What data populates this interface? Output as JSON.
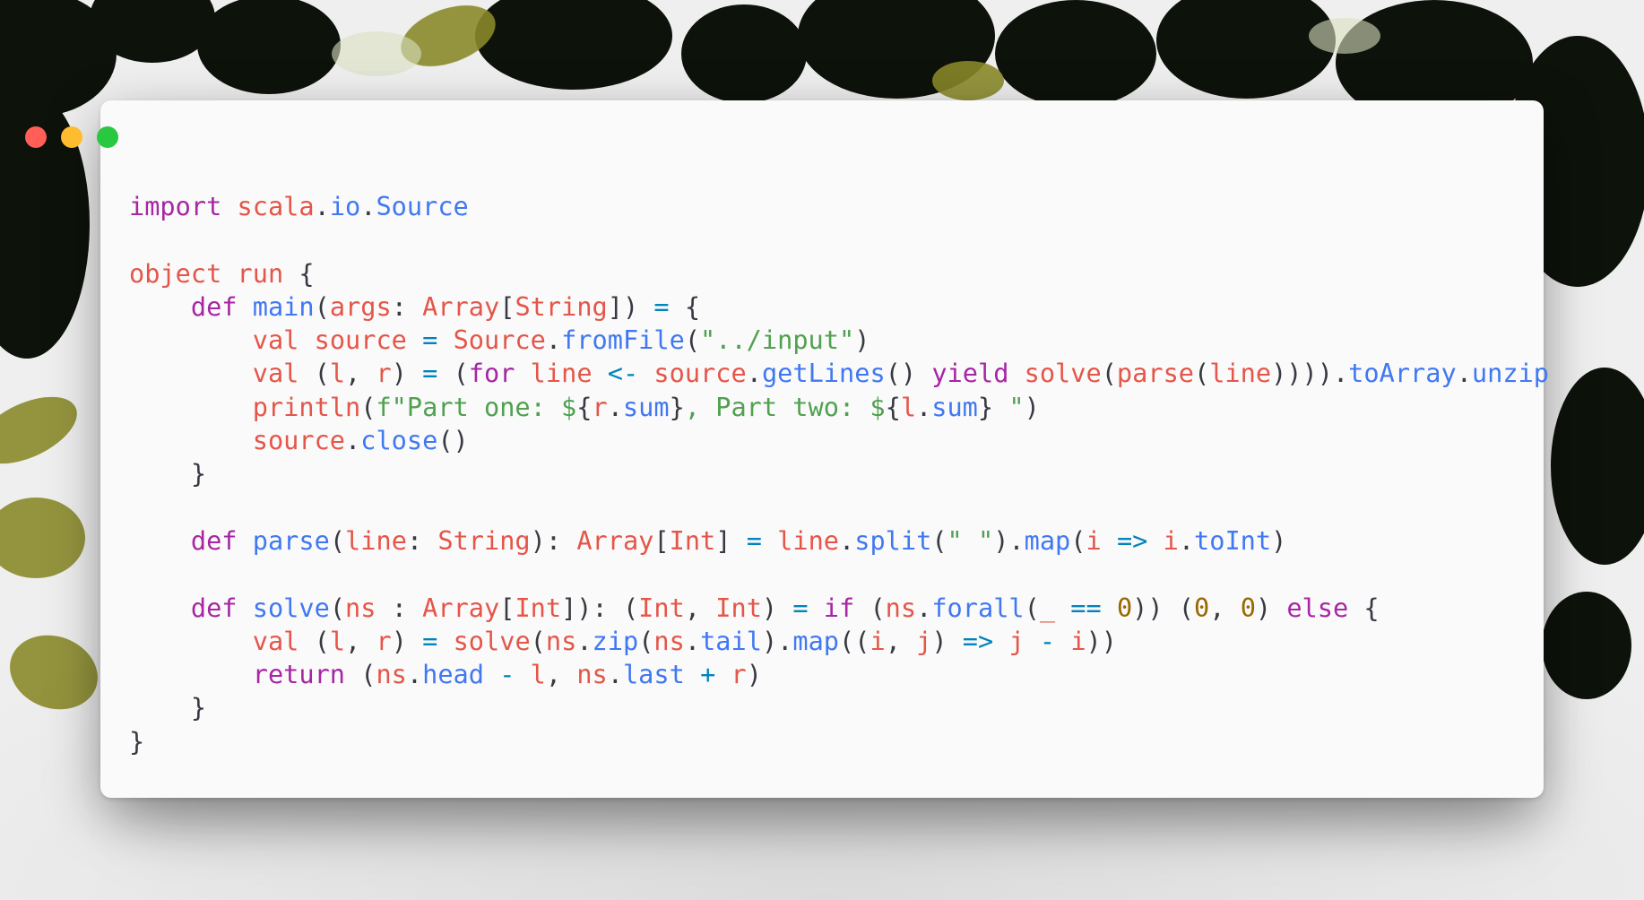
{
  "window": {
    "buttons": [
      {
        "name": "close-button",
        "color": "#ff5f57"
      },
      {
        "name": "minimize-button",
        "color": "#febc2e"
      },
      {
        "name": "maximize-button",
        "color": "#28c840"
      }
    ]
  },
  "colors": {
    "keyword": "#a626a4",
    "identifier": "#e45649",
    "method": "#4078f2",
    "string": "#50a14f",
    "number": "#986801",
    "operator": "#0184bc",
    "plain": "#383a42"
  },
  "code": {
    "language": "Scala",
    "lines": [
      [
        [
          "keyword",
          "import"
        ],
        [
          "plain",
          " "
        ],
        [
          "identifier",
          "scala"
        ],
        [
          "plain",
          "."
        ],
        [
          "method",
          "io"
        ],
        [
          "plain",
          "."
        ],
        [
          "method",
          "Source"
        ]
      ],
      [],
      [
        [
          "identifier",
          "object"
        ],
        [
          "plain",
          " "
        ],
        [
          "identifier",
          "run"
        ],
        [
          "plain",
          " {"
        ]
      ],
      [
        [
          "plain",
          "    "
        ],
        [
          "keyword",
          "def"
        ],
        [
          "plain",
          " "
        ],
        [
          "method",
          "main"
        ],
        [
          "plain",
          "("
        ],
        [
          "identifier",
          "args"
        ],
        [
          "plain",
          ": "
        ],
        [
          "identifier",
          "Array"
        ],
        [
          "plain",
          "["
        ],
        [
          "identifier",
          "String"
        ],
        [
          "plain",
          "]) "
        ],
        [
          "operator",
          "="
        ],
        [
          "plain",
          " {"
        ]
      ],
      [
        [
          "plain",
          "        "
        ],
        [
          "identifier",
          "val"
        ],
        [
          "plain",
          " "
        ],
        [
          "identifier",
          "source"
        ],
        [
          "plain",
          " "
        ],
        [
          "operator",
          "="
        ],
        [
          "plain",
          " "
        ],
        [
          "identifier",
          "Source"
        ],
        [
          "plain",
          "."
        ],
        [
          "method",
          "fromFile"
        ],
        [
          "plain",
          "("
        ],
        [
          "string",
          "\"../input\""
        ],
        [
          "plain",
          ")"
        ]
      ],
      [
        [
          "plain",
          "        "
        ],
        [
          "identifier",
          "val"
        ],
        [
          "plain",
          " ("
        ],
        [
          "identifier",
          "l"
        ],
        [
          "plain",
          ", "
        ],
        [
          "identifier",
          "r"
        ],
        [
          "plain",
          ") "
        ],
        [
          "operator",
          "="
        ],
        [
          "plain",
          " ("
        ],
        [
          "keyword",
          "for"
        ],
        [
          "plain",
          " "
        ],
        [
          "identifier",
          "line"
        ],
        [
          "plain",
          " "
        ],
        [
          "operator",
          "<-"
        ],
        [
          "plain",
          " "
        ],
        [
          "identifier",
          "source"
        ],
        [
          "plain",
          "."
        ],
        [
          "method",
          "getLines"
        ],
        [
          "plain",
          "() "
        ],
        [
          "keyword",
          "yield"
        ],
        [
          "plain",
          " "
        ],
        [
          "identifier",
          "solve"
        ],
        [
          "plain",
          "("
        ],
        [
          "identifier",
          "parse"
        ],
        [
          "plain",
          "("
        ],
        [
          "identifier",
          "line"
        ],
        [
          "plain",
          "))))."
        ],
        [
          "method",
          "toArray"
        ],
        [
          "plain",
          "."
        ],
        [
          "method",
          "unzip"
        ]
      ],
      [
        [
          "plain",
          "        "
        ],
        [
          "identifier",
          "println"
        ],
        [
          "plain",
          "("
        ],
        [
          "string",
          "f\"Part one: $"
        ],
        [
          "plain",
          "{"
        ],
        [
          "identifier",
          "r"
        ],
        [
          "plain",
          "."
        ],
        [
          "method",
          "sum"
        ],
        [
          "plain",
          "}"
        ],
        [
          "string",
          ", Part two: $"
        ],
        [
          "plain",
          "{"
        ],
        [
          "identifier",
          "l"
        ],
        [
          "plain",
          "."
        ],
        [
          "method",
          "sum"
        ],
        [
          "plain",
          "}"
        ],
        [
          "string",
          " \""
        ],
        [
          "plain",
          ")"
        ]
      ],
      [
        [
          "plain",
          "        "
        ],
        [
          "identifier",
          "source"
        ],
        [
          "plain",
          "."
        ],
        [
          "method",
          "close"
        ],
        [
          "plain",
          "()"
        ]
      ],
      [
        [
          "plain",
          "    }"
        ]
      ],
      [],
      [
        [
          "plain",
          "    "
        ],
        [
          "keyword",
          "def"
        ],
        [
          "plain",
          " "
        ],
        [
          "method",
          "parse"
        ],
        [
          "plain",
          "("
        ],
        [
          "identifier",
          "line"
        ],
        [
          "plain",
          ": "
        ],
        [
          "identifier",
          "String"
        ],
        [
          "plain",
          "): "
        ],
        [
          "identifier",
          "Array"
        ],
        [
          "plain",
          "["
        ],
        [
          "identifier",
          "Int"
        ],
        [
          "plain",
          "] "
        ],
        [
          "operator",
          "="
        ],
        [
          "plain",
          " "
        ],
        [
          "identifier",
          "line"
        ],
        [
          "plain",
          "."
        ],
        [
          "method",
          "split"
        ],
        [
          "plain",
          "("
        ],
        [
          "string",
          "\" \""
        ],
        [
          "plain",
          ")."
        ],
        [
          "method",
          "map"
        ],
        [
          "plain",
          "("
        ],
        [
          "identifier",
          "i"
        ],
        [
          "plain",
          " "
        ],
        [
          "operator",
          "=>"
        ],
        [
          "plain",
          " "
        ],
        [
          "identifier",
          "i"
        ],
        [
          "plain",
          "."
        ],
        [
          "method",
          "toInt"
        ],
        [
          "plain",
          ")"
        ]
      ],
      [],
      [
        [
          "plain",
          "    "
        ],
        [
          "keyword",
          "def"
        ],
        [
          "plain",
          " "
        ],
        [
          "method",
          "solve"
        ],
        [
          "plain",
          "("
        ],
        [
          "identifier",
          "ns"
        ],
        [
          "plain",
          " : "
        ],
        [
          "identifier",
          "Array"
        ],
        [
          "plain",
          "["
        ],
        [
          "identifier",
          "Int"
        ],
        [
          "plain",
          "]): ("
        ],
        [
          "identifier",
          "Int"
        ],
        [
          "plain",
          ", "
        ],
        [
          "identifier",
          "Int"
        ],
        [
          "plain",
          ") "
        ],
        [
          "operator",
          "="
        ],
        [
          "plain",
          " "
        ],
        [
          "keyword",
          "if"
        ],
        [
          "plain",
          " ("
        ],
        [
          "identifier",
          "ns"
        ],
        [
          "plain",
          "."
        ],
        [
          "method",
          "forall"
        ],
        [
          "plain",
          "("
        ],
        [
          "identifier",
          "_"
        ],
        [
          "plain",
          " "
        ],
        [
          "operator",
          "=="
        ],
        [
          "plain",
          " "
        ],
        [
          "number",
          "0"
        ],
        [
          "plain",
          ")) ("
        ],
        [
          "number",
          "0"
        ],
        [
          "plain",
          ", "
        ],
        [
          "number",
          "0"
        ],
        [
          "plain",
          ") "
        ],
        [
          "keyword",
          "else"
        ],
        [
          "plain",
          " {"
        ]
      ],
      [
        [
          "plain",
          "        "
        ],
        [
          "identifier",
          "val"
        ],
        [
          "plain",
          " ("
        ],
        [
          "identifier",
          "l"
        ],
        [
          "plain",
          ", "
        ],
        [
          "identifier",
          "r"
        ],
        [
          "plain",
          ") "
        ],
        [
          "operator",
          "="
        ],
        [
          "plain",
          " "
        ],
        [
          "identifier",
          "solve"
        ],
        [
          "plain",
          "("
        ],
        [
          "identifier",
          "ns"
        ],
        [
          "plain",
          "."
        ],
        [
          "method",
          "zip"
        ],
        [
          "plain",
          "("
        ],
        [
          "identifier",
          "ns"
        ],
        [
          "plain",
          "."
        ],
        [
          "method",
          "tail"
        ],
        [
          "plain",
          ")."
        ],
        [
          "method",
          "map"
        ],
        [
          "plain",
          "(("
        ],
        [
          "identifier",
          "i"
        ],
        [
          "plain",
          ", "
        ],
        [
          "identifier",
          "j"
        ],
        [
          "plain",
          ") "
        ],
        [
          "operator",
          "=>"
        ],
        [
          "plain",
          " "
        ],
        [
          "identifier",
          "j"
        ],
        [
          "plain",
          " "
        ],
        [
          "operator",
          "-"
        ],
        [
          "plain",
          " "
        ],
        [
          "identifier",
          "i"
        ],
        [
          "plain",
          "))"
        ]
      ],
      [
        [
          "plain",
          "        "
        ],
        [
          "keyword",
          "return"
        ],
        [
          "plain",
          " ("
        ],
        [
          "identifier",
          "ns"
        ],
        [
          "plain",
          "."
        ],
        [
          "method",
          "head"
        ],
        [
          "plain",
          " "
        ],
        [
          "operator",
          "-"
        ],
        [
          "plain",
          " "
        ],
        [
          "identifier",
          "l"
        ],
        [
          "plain",
          ", "
        ],
        [
          "identifier",
          "ns"
        ],
        [
          "plain",
          "."
        ],
        [
          "method",
          "last"
        ],
        [
          "plain",
          " "
        ],
        [
          "operator",
          "+"
        ],
        [
          "plain",
          " "
        ],
        [
          "identifier",
          "r"
        ],
        [
          "plain",
          ")"
        ]
      ],
      [
        [
          "plain",
          "    }"
        ]
      ],
      [
        [
          "plain",
          "}"
        ]
      ]
    ]
  }
}
